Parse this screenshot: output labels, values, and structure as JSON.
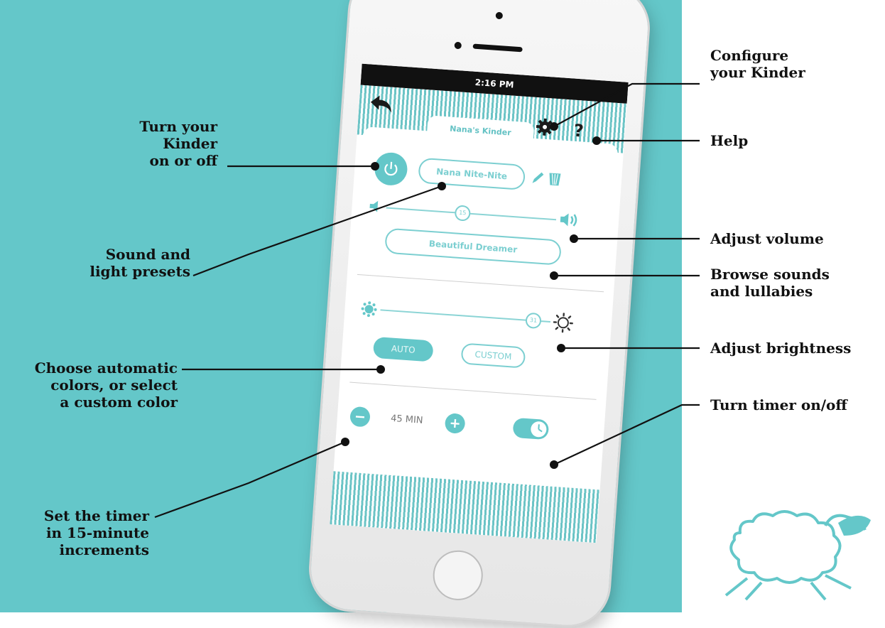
{
  "phone": {
    "time": "2:16 PM",
    "device_name": "Nana's Kinder",
    "preset_name": "Nana Nite-Nite",
    "volume_value": "15",
    "sound_name": "Beautiful Dreamer",
    "brightness_value": "31",
    "auto_label": "AUTO",
    "custom_label": "CUSTOM",
    "timer_value": "45 MIN",
    "volume_level": 0.45,
    "brightness_level": 0.9,
    "timer_enabled": true
  },
  "callouts": {
    "configure": [
      "Configure",
      "your Kinder"
    ],
    "help": "Help",
    "power": [
      "Turn your",
      "Kinder",
      "on or off"
    ],
    "presets": [
      "Sound and",
      "light presets"
    ],
    "volume": "Adjust volume",
    "browse": [
      "Browse sounds",
      "and lullabies"
    ],
    "brightness": "Adjust brightness",
    "colors": [
      "Choose automatic",
      "colors, or select",
      "a custom color"
    ],
    "timer_toggle": "Turn timer on/off",
    "timer_set": [
      "Set the timer",
      "in 15-minute",
      "increments"
    ]
  },
  "colors": {
    "teal": "#64c7c9",
    "accent": "#7ccfd1",
    "ink": "#111111"
  },
  "icons": [
    "back-arrow-icon",
    "gear-icon",
    "help-icon",
    "power-icon",
    "pencil-icon",
    "trash-icon",
    "speaker-low-icon",
    "speaker-high-icon",
    "sun-dim-icon",
    "sun-bright-icon",
    "minus-icon",
    "plus-icon",
    "timer-toggle-icon",
    "sheep-icon"
  ]
}
